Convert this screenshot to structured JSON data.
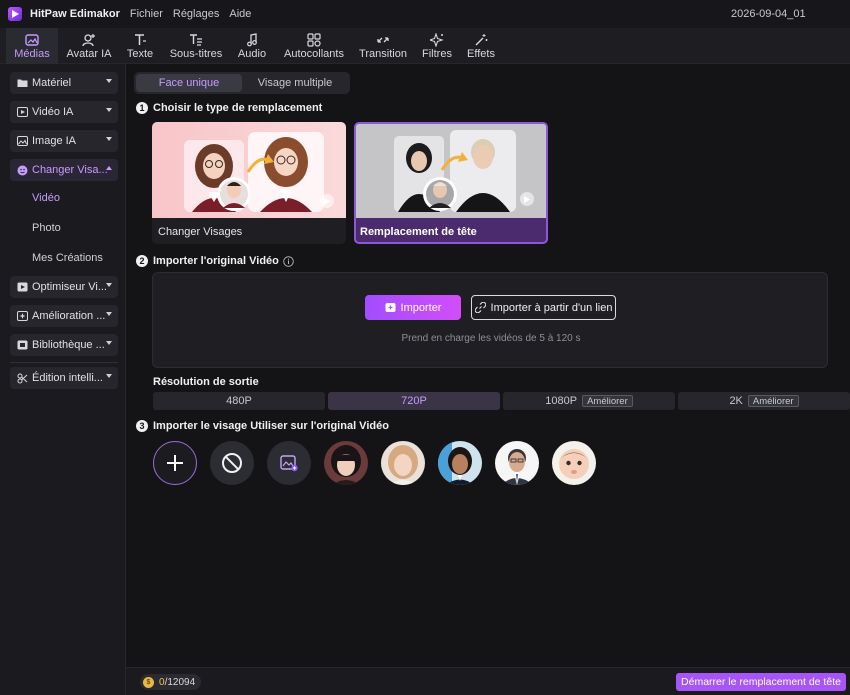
{
  "titlebar": {
    "app_name": "HitPaw Edimakor",
    "menus": [
      "Fichier",
      "Réglages",
      "Aide"
    ],
    "document": "2026-09-04_01"
  },
  "toolbar": {
    "tabs": [
      {
        "label": "Médias",
        "icon": "media-icon",
        "active": true
      },
      {
        "label": "Avatar IA",
        "icon": "avatar-icon"
      },
      {
        "label": "Texte",
        "icon": "text-icon"
      },
      {
        "label": "Sous-titres",
        "icon": "subtitles-icon"
      },
      {
        "label": "Audio",
        "icon": "music-note-icon"
      },
      {
        "label": "Autocollants",
        "icon": "stickers-icon"
      },
      {
        "label": "Transition",
        "icon": "transition-icon"
      },
      {
        "label": "Filtres",
        "icon": "sparkle-icon"
      },
      {
        "label": "Effets",
        "icon": "magic-wand-icon"
      }
    ]
  },
  "sidebar": {
    "items": [
      {
        "label": "Matériel",
        "icon": "folder-icon"
      },
      {
        "label": "Vidéo IA",
        "icon": "ai-video-icon"
      },
      {
        "label": "Image IA",
        "icon": "ai-image-icon"
      },
      {
        "label": "Changer Visa...",
        "icon": "face-swap-icon",
        "expanded": true
      },
      {
        "label": "Optimiseur Vi...",
        "icon": "video-optimizer-icon"
      },
      {
        "label": "Amélioration ...",
        "icon": "enhance-icon"
      },
      {
        "label": "Bibliothèque ...",
        "icon": "library-icon"
      },
      {
        "label": "Édition intelli...",
        "icon": "smart-edit-icon"
      }
    ],
    "subitems": [
      {
        "label": "Vidéo",
        "active": true
      },
      {
        "label": "Photo"
      },
      {
        "label": "Mes Créations"
      }
    ]
  },
  "main": {
    "segments": [
      {
        "label": "Face unique",
        "active": true
      },
      {
        "label": "Visage multiple"
      }
    ],
    "step1": {
      "num": "1",
      "title": "Choisir le type de remplacement"
    },
    "cards": [
      {
        "label": "Changer Visages"
      },
      {
        "label": "Remplacement de tête",
        "selected": true
      }
    ],
    "step2": {
      "num": "2",
      "title": "Importer l'original Vidéo"
    },
    "import_button": "Importer",
    "link_button": "Importer à partir d'un lien",
    "hint": "Prend en charge les vidéos de 5 à 120 s",
    "resolution_label": "Résolution de sortie",
    "resolutions": [
      {
        "label": "480P"
      },
      {
        "label": "720P",
        "active": true
      },
      {
        "label": "1080P",
        "badge": "Améliorer"
      },
      {
        "label": "2K",
        "badge": "Améliorer"
      }
    ],
    "step3": {
      "num": "3",
      "title": "Importer le visage Utiliser sur l'original Vidéo"
    },
    "faces": [
      "face-woman-black-bob",
      "face-woman-blonde",
      "face-woman-dark-hair",
      "face-man-suit-glasses",
      "face-baby"
    ]
  },
  "footer": {
    "credits_used": "0",
    "credits_total": "/12094",
    "start_button": "Démarrer le remplacement de tête"
  },
  "colors": {
    "accent": "#a855f7",
    "accent_text": "#c79bff",
    "background": "#141417"
  }
}
